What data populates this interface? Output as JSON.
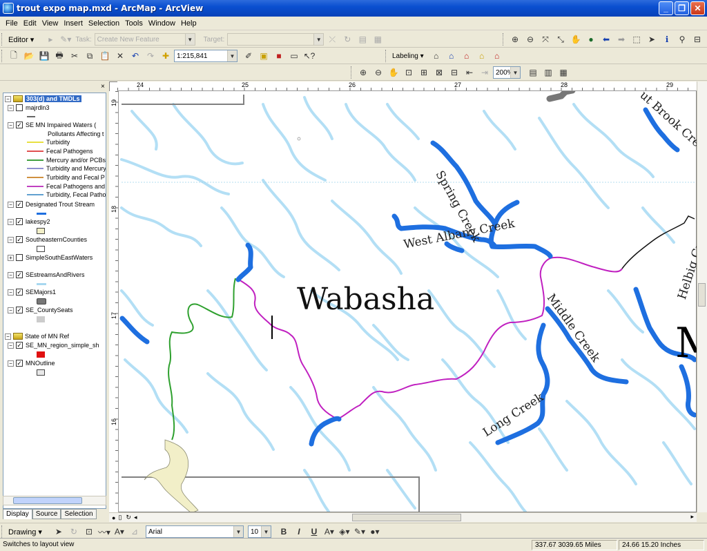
{
  "window": {
    "title": "trout expo map.mxd - ArcMap - ArcView",
    "minimize": "_",
    "maximize": "❐",
    "close": "✕"
  },
  "menu": [
    "File",
    "Edit",
    "View",
    "Insert",
    "Selection",
    "Tools",
    "Window",
    "Help"
  ],
  "editor_toolbar": {
    "editor_label": "Editor ▾",
    "task_label": "Task:",
    "task_value": "Create New Feature",
    "target_label": "Target:",
    "target_value": ""
  },
  "standard_toolbar": {
    "scale": "1:215,841"
  },
  "labeling_toolbar": {
    "label": "Labeling ▾"
  },
  "layout_toolbar": {
    "zoom": "200%"
  },
  "toc": {
    "title": "303(d) and TMDLs",
    "layers": [
      {
        "name": "majrdln3",
        "checked": false
      },
      {
        "name": "SE MN Impaired Waters (",
        "checked": true
      },
      {
        "name": "Pollutants Affecting t"
      },
      {
        "name": "Turbidity",
        "color": "#e8e040"
      },
      {
        "name": "Fecal Pathogens",
        "color": "#e05050"
      },
      {
        "name": "Mercury and/or PCBs",
        "color": "#40a040"
      },
      {
        "name": "Turbidity and Mercury",
        "color": "#9090d0"
      },
      {
        "name": "Turbidity and Fecal P",
        "color": "#d09040"
      },
      {
        "name": "Fecal Pathogens and",
        "color": "#c040c0"
      },
      {
        "name": "Turbidity, Fecal Patho",
        "color": "#60a0d0"
      },
      {
        "name": "Designated Trout Stream",
        "checked": true,
        "color": "#1e6fe0"
      },
      {
        "name": "lakespy2",
        "checked": true,
        "color": "#f2efc8"
      },
      {
        "name": "SoutheasternCounties",
        "checked": true,
        "color": "#ffffff"
      },
      {
        "name": "SimpleSouthEastWaters",
        "checked": false
      },
      {
        "name": "SEstreamsAndRivers",
        "checked": true,
        "color": "#a8d8f0"
      },
      {
        "name": "SEMajors1",
        "checked": true,
        "color": "#777777"
      },
      {
        "name": "SE_CountySeats",
        "checked": true,
        "color": "#cccccc"
      },
      {
        "name": "State of MN Ref"
      },
      {
        "name": "SE_MN_region_simple_sh",
        "checked": true,
        "color": "#e01010"
      },
      {
        "name": "MNOutline",
        "checked": true,
        "color": "#e8e8e8"
      }
    ],
    "tabs": [
      "Display",
      "Source",
      "Selection"
    ]
  },
  "ruler": {
    "h": [
      "24",
      "25",
      "26",
      "27",
      "28",
      "29"
    ],
    "v": [
      "19",
      "18",
      "17",
      "16"
    ]
  },
  "map": {
    "county_label": "Wabasha",
    "stream_labels": [
      "Spring Creek",
      "West Albany Creek",
      "Middle Creek",
      "Long Creek",
      "ut Brook Cre",
      "Helbig Cr",
      "M"
    ],
    "colors": {
      "streams": "#b3dff5",
      "trout": "#1e6fe0",
      "fecal": "#c020c0",
      "mercury": "#2ea02e",
      "lake": "#f2efc8",
      "county": "#808080",
      "outline": "#000000"
    }
  },
  "drawing_toolbar": {
    "drawing_label": "Drawing ▾",
    "font": "Arial",
    "size": "10",
    "bold": "B",
    "italic": "I",
    "underline": "U"
  },
  "status": {
    "message": "Switches to layout view",
    "coords_map": "337.67  3039.65 Miles",
    "coords_page": "24.66  15.20 Inches"
  }
}
